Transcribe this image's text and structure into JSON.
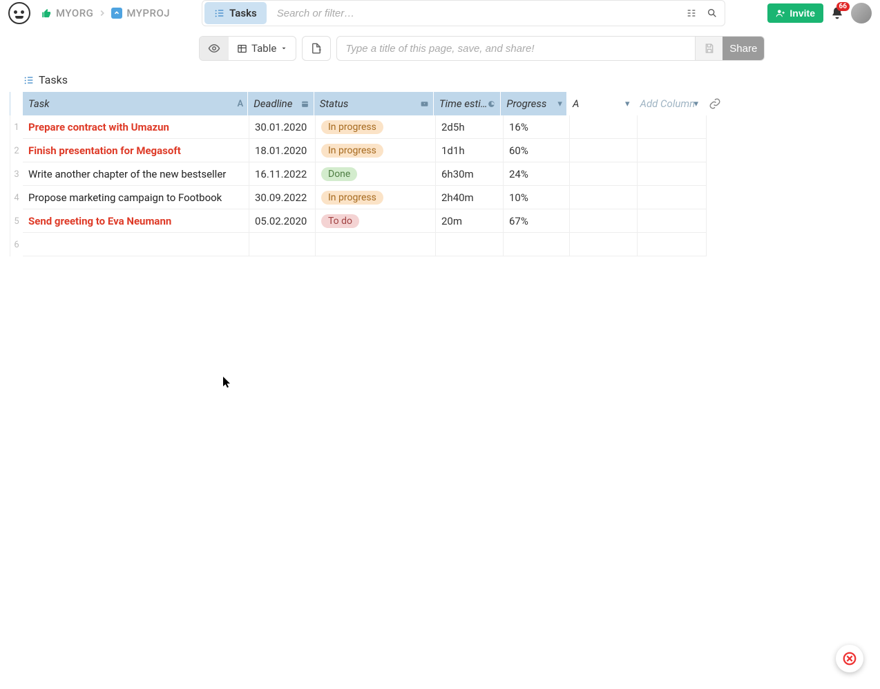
{
  "breadcrumb": {
    "org": "MYORG",
    "project": "MYPROJ"
  },
  "tab": {
    "label": "Tasks"
  },
  "search": {
    "placeholder": "Search or filter…"
  },
  "invite": {
    "label": "Invite"
  },
  "notifications": {
    "count": "66"
  },
  "toolbar": {
    "view_label": "Table",
    "title_placeholder": "Type a title of this page, save, and share!",
    "share_label": "Share"
  },
  "page": {
    "title": "Tasks"
  },
  "columns": {
    "task": "Task",
    "deadline": "Deadline",
    "status": "Status",
    "time": "Time esti…",
    "progress": "Progress",
    "a": "A",
    "add": "Add Column"
  },
  "type_hints": {
    "task": "A",
    "deadline": "▦",
    "status": "▾",
    "time": "◔",
    "progress": "▾",
    "a": "▾",
    "add": "▾"
  },
  "rows": [
    {
      "num": "1",
      "task": "Prepare contract with Umazun",
      "highlight": true,
      "deadline": "30.01.2020",
      "status": "In progress",
      "status_kind": "in-progress",
      "time": "2d5h",
      "progress": "16%"
    },
    {
      "num": "2",
      "task": "Finish presentation for Megasoft",
      "highlight": true,
      "deadline": "18.01.2020",
      "status": "In progress",
      "status_kind": "in-progress",
      "time": "1d1h",
      "progress": "60%"
    },
    {
      "num": "3",
      "task": "Write another chapter of the new bestseller",
      "highlight": false,
      "deadline": "16.11.2022",
      "status": "Done",
      "status_kind": "done",
      "time": "6h30m",
      "progress": "24%"
    },
    {
      "num": "4",
      "task": "Propose marketing campaign to Footbook",
      "highlight": false,
      "deadline": "30.09.2022",
      "status": "In progress",
      "status_kind": "in-progress",
      "time": "2h40m",
      "progress": "10%"
    },
    {
      "num": "5",
      "task": "Send greeting to Eva Neumann",
      "highlight": true,
      "deadline": "05.02.2020",
      "status": "To do",
      "status_kind": "todo",
      "time": "20m",
      "progress": "67%"
    }
  ],
  "empty_row_num": "6"
}
